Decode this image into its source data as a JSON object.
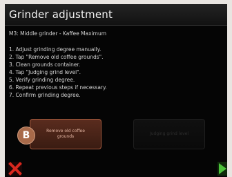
{
  "header": {
    "title": "Grinder adjustment"
  },
  "subtitle": "M3: Middle grinder  - Kaffee Maximum",
  "steps": [
    "1. Adjust grinding degree manually.",
    "2. Tap \"Remove old coffee grounds\".",
    "3. Clean grounds container.",
    "4. Tap \"Judging grind level\".",
    "5. Verify grinding degree.",
    "6. Repeat previous steps if necessary.",
    "7. Confirm grinding degree."
  ],
  "buttons": {
    "remove_label": "Remove old coffee grounds",
    "judge_label": "Judging grind level",
    "judge_state": "disabled"
  },
  "marker": {
    "label": "B"
  },
  "footer": {
    "cancel_icon": "cancel-x-icon",
    "next_icon": "play-next-icon"
  },
  "colors": {
    "accent": "#a45a3e",
    "cancel": "#d9281f",
    "confirm": "#4cc23a"
  }
}
